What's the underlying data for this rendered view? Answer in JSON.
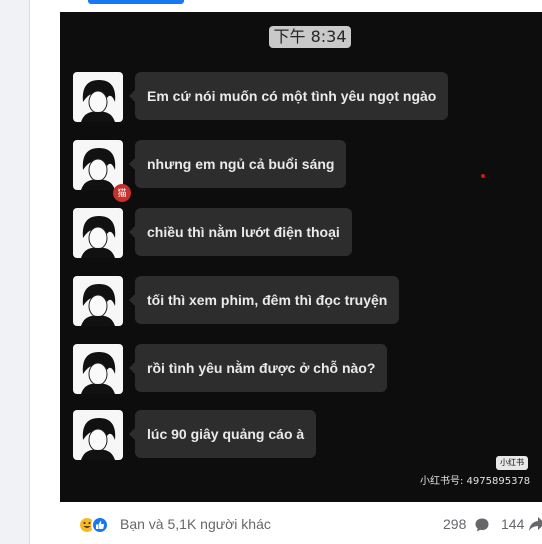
{
  "post": {
    "image": {
      "time": "下午 8:34",
      "messages": [
        {
          "text": "Em cứ nói muốn có một tình yêu ngọt ngào"
        },
        {
          "text": "nhưng em ngủ cả buổi sáng"
        },
        {
          "text": "chiều thì nằm lướt điện thoại"
        },
        {
          "text": "tối thì xem phim, đêm thì đọc truyện"
        },
        {
          "text": "rồi tình yêu nằm được ở chỗ nào?"
        },
        {
          "text": "lúc 90 giây quảng cáo à"
        }
      ],
      "stamp_text": "猫",
      "watermark_logo": "小红书",
      "watermark_id": "小红书号: 4975895378"
    },
    "footer": {
      "reactions_text": "Bạn và 5,1K người khác",
      "comments_count": "298",
      "shares_count": "144"
    },
    "colors": {
      "like_blue": "#1877f2",
      "haha_yellow": "#f7b928",
      "bubble_bg": "#2d2d2d",
      "image_bg": "#0d0d0d"
    }
  }
}
